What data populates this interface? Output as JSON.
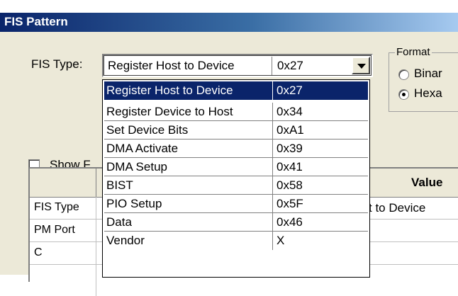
{
  "window": {
    "title": "FIS Pattern"
  },
  "fis_type": {
    "label": "FIS Type:",
    "selected_name": "Register Host to Device",
    "selected_code": "0x27"
  },
  "format": {
    "legend": "Format",
    "options": [
      "Binar",
      "Hexa"
    ],
    "selected": "Hexa"
  },
  "show_checkbox": {
    "label": "Show F",
    "checked": false
  },
  "table": {
    "header_value": "Value",
    "rows": [
      {
        "name": "FIS Type",
        "value": "t to Device"
      },
      {
        "name": "PM Port",
        "value": ""
      },
      {
        "name": "C",
        "value": ""
      }
    ]
  },
  "dropdown": {
    "options": [
      {
        "name": "Register Host to Device",
        "code": "0x27"
      },
      {
        "name": "Register Device to Host",
        "code": "0x34"
      },
      {
        "name": "Set Device Bits",
        "code": "0xA1"
      },
      {
        "name": "DMA Activate",
        "code": "0x39"
      },
      {
        "name": "DMA Setup",
        "code": "0x41"
      },
      {
        "name": "BIST",
        "code": "0x58"
      },
      {
        "name": "PIO Setup",
        "code": "0x5F"
      },
      {
        "name": "Data",
        "code": "0x46"
      },
      {
        "name": "Vendor",
        "code": "X"
      }
    ],
    "selected_index": 0
  },
  "colors": {
    "selection": "#0a246a",
    "face": "#ece9d8"
  }
}
